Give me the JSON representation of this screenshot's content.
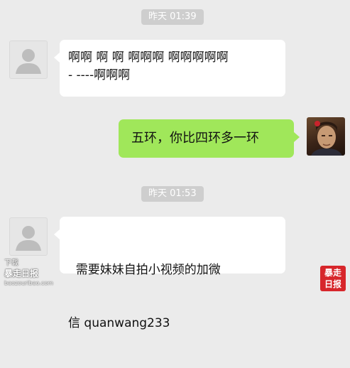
{
  "messages": [
    {
      "type": "time",
      "text": "昨天 01:39"
    },
    {
      "type": "received",
      "line1": "啊啊 啊 啊 啊啊啊 啊啊啊啊啊",
      "line2": "- ----啊啊啊"
    },
    {
      "type": "sent",
      "text": "五环，你比四环多一环"
    },
    {
      "type": "time",
      "text": "昨天 01:53"
    },
    {
      "type": "received",
      "line1": "  需要妹妹自拍小视频的加微",
      "line2": "信 quanwang233"
    }
  ],
  "watermark": {
    "line1": "下载",
    "line2": "暴走日报",
    "line3": "baozouribao.com",
    "logo_line1": "暴走",
    "logo_line2": "日报"
  },
  "colors": {
    "background": "#ebebeb",
    "sent_bubble": "#a0e75a",
    "received_bubble": "#ffffff",
    "time_pill": "#cecece",
    "logo": "#d7262b"
  }
}
